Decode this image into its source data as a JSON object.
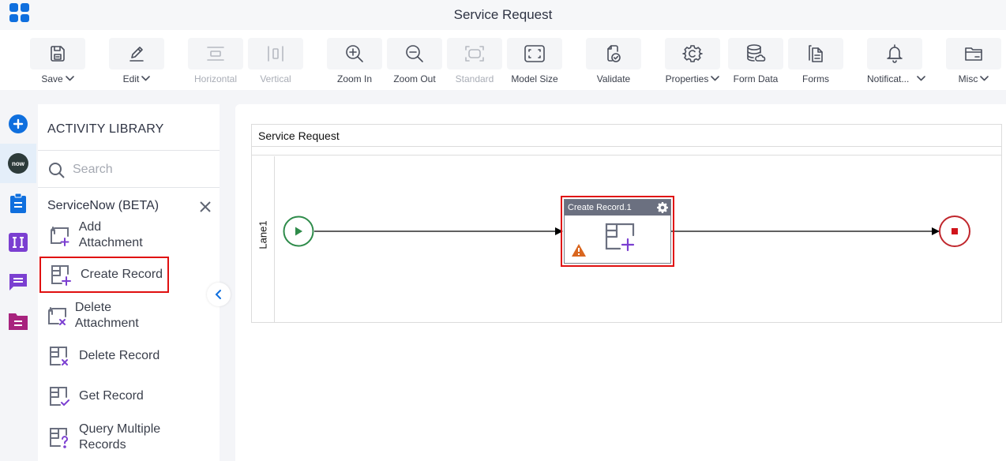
{
  "header": {
    "title": "Service Request",
    "app_menu_icon": "app-grid-icon"
  },
  "toolbar": {
    "buttons": [
      {
        "label": "Save",
        "icon": "save-icon",
        "dropdown": true,
        "enabled": true
      },
      {
        "label": "Edit",
        "icon": "edit-pencil-icon",
        "dropdown": true,
        "enabled": true
      },
      {
        "label": "Horizontal",
        "icon": "horizontal-layout-icon",
        "dropdown": false,
        "enabled": false
      },
      {
        "label": "Vertical",
        "icon": "vertical-layout-icon",
        "dropdown": false,
        "enabled": false
      },
      {
        "label": "Zoom In",
        "icon": "zoom-in-icon",
        "dropdown": false,
        "enabled": true
      },
      {
        "label": "Zoom Out",
        "icon": "zoom-out-icon",
        "dropdown": false,
        "enabled": true
      },
      {
        "label": "Standard",
        "icon": "standard-size-icon",
        "dropdown": false,
        "enabled": false
      },
      {
        "label": "Model Size",
        "icon": "model-size-icon",
        "dropdown": false,
        "enabled": true
      },
      {
        "label": "Validate",
        "icon": "validate-icon",
        "dropdown": false,
        "enabled": true
      },
      {
        "label": "Properties",
        "icon": "gear-icon",
        "dropdown": true,
        "enabled": true
      },
      {
        "label": "Form Data",
        "icon": "form-data-icon",
        "dropdown": false,
        "enabled": true
      },
      {
        "label": "Forms",
        "icon": "forms-icon",
        "dropdown": false,
        "enabled": true
      },
      {
        "label": "Notificat...",
        "icon": "bell-icon",
        "dropdown": true,
        "enabled": true
      },
      {
        "label": "Misc",
        "icon": "folder-icon",
        "dropdown": true,
        "enabled": true
      }
    ]
  },
  "rail": {
    "items": [
      {
        "name": "add",
        "icon": "plus-circle-icon",
        "active": false
      },
      {
        "name": "servicenow",
        "icon": "servicenow-logo-icon",
        "text": "now",
        "active": true
      },
      {
        "name": "clipboard",
        "icon": "clipboard-icon",
        "active": false
      },
      {
        "name": "text-field",
        "icon": "text-field-icon",
        "active": false
      },
      {
        "name": "message",
        "icon": "message-icon",
        "active": false
      },
      {
        "name": "folder",
        "icon": "folder-document-icon",
        "active": false
      }
    ]
  },
  "library": {
    "title": "ACTIVITY LIBRARY",
    "search_placeholder": "Search",
    "search_value": "",
    "category": "ServiceNow (BETA)",
    "items": [
      {
        "label": "Add Attachment",
        "icon": "add-attachment-icon",
        "selected": false
      },
      {
        "label": "Create Record",
        "icon": "create-record-icon",
        "selected": true
      },
      {
        "label": "Delete Attachment",
        "icon": "delete-attachment-icon",
        "selected": false
      },
      {
        "label": "Delete Record",
        "icon": "delete-record-icon",
        "selected": false
      },
      {
        "label": "Get Record",
        "icon": "get-record-icon",
        "selected": false
      },
      {
        "label": "Query Multiple Records",
        "icon": "query-records-icon",
        "selected": false
      }
    ]
  },
  "canvas": {
    "pool_title": "Service Request",
    "lane_label": "Lane1",
    "start_event": {
      "type": "start",
      "color": "#2e8b4a"
    },
    "task": {
      "title": "Create Record.1",
      "icon": "create-record-icon",
      "warning": true,
      "selected": true
    },
    "end_event": {
      "type": "end",
      "color": "#c0272d"
    }
  },
  "colors": {
    "accent": "#0f6fde",
    "selection": "#e01010",
    "purple": "#7b3fd1",
    "warning": "#d9661f"
  }
}
